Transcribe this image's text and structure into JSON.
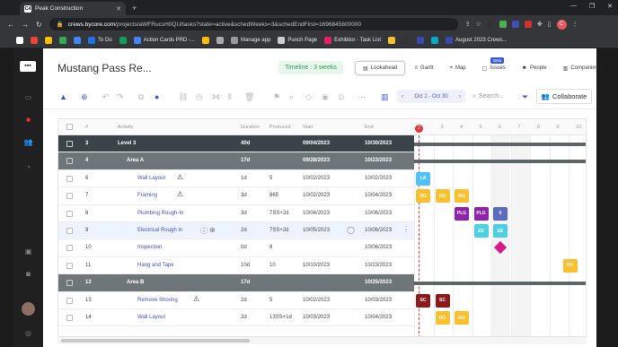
{
  "browser": {
    "tab_title": "Peak Construction",
    "tab_favicon": "C4",
    "url_host": "crews.bycore.com",
    "url_path": "/projects/aWFRucsH0QU/tasks?state=active&schedWeeks=3&schedEndFirst=1696845600000",
    "bookmarks": [
      "To Do",
      "Action Cards PRD -...",
      "Manage app",
      "Punch Page",
      "Exhibitor - Task List",
      "August 2023 Crews..."
    ]
  },
  "header": {
    "project_title": "Mustang Pass Re...",
    "timeline_label": "Timeline : 3 weeks",
    "beta_badge": "Beta",
    "views": [
      "Lookahead",
      "Gantt",
      "Map",
      "Issues",
      "People",
      "Companies"
    ]
  },
  "toolbar": {
    "date_range": "Oct 2 - Oct 30",
    "search_placeholder": "Search...",
    "collaborate_label": "Collaborate"
  },
  "table": {
    "columns": [
      "#",
      "Activity",
      "Duration",
      "Produced",
      "Start",
      "End"
    ],
    "rows": [
      {
        "num": "3",
        "activity": "Level 3",
        "duration": "40d",
        "produced": "",
        "start": "09/04/2023",
        "end": "10/30/2023",
        "kind": "group"
      },
      {
        "num": "4",
        "activity": "Area A",
        "duration": "17d",
        "produced": "",
        "start": "09/28/2023",
        "end": "10/23/2023",
        "kind": "sub"
      },
      {
        "num": "6",
        "activity": "Wall Layout",
        "duration": "1d",
        "produced": "5",
        "start": "10/02/2023",
        "end": "10/02/2023",
        "kind": "task",
        "warn": true
      },
      {
        "num": "7",
        "activity": "Framing",
        "duration": "3d",
        "produced": "865",
        "start": "10/02/2023",
        "end": "10/04/2023",
        "kind": "task",
        "warn": true
      },
      {
        "num": "8",
        "activity": "Plumbing Rough-In",
        "duration": "3d",
        "produced": "7SS+2d",
        "start": "10/04/2023",
        "end": "10/06/2023",
        "kind": "task"
      },
      {
        "num": "9",
        "activity": "Electrical Rough In",
        "duration": "2d",
        "produced": "7SS+2d",
        "start": "10/05/2023",
        "end": "10/06/2023",
        "kind": "sel"
      },
      {
        "num": "10",
        "activity": "Inspection",
        "duration": "0d",
        "produced": "8",
        "start": "",
        "end": "10/06/2023",
        "kind": "task"
      },
      {
        "num": "11",
        "activity": "Hang and Tape",
        "duration": "10d",
        "produced": "10",
        "start": "10/10/2023",
        "end": "10/23/2023",
        "kind": "task"
      },
      {
        "num": "12",
        "activity": "Area B",
        "duration": "17d",
        "produced": "",
        "start": "",
        "end": "10/25/2023",
        "kind": "sub"
      },
      {
        "num": "13",
        "activity": "Remove Shoring",
        "duration": "2d",
        "produced": "5",
        "start": "10/02/2023",
        "end": "10/03/2023",
        "kind": "task",
        "warn": true
      },
      {
        "num": "14",
        "activity": "Wall Layout",
        "duration": "2d",
        "produced": "13SS+1d",
        "start": "10/03/2023",
        "end": "10/04/2023",
        "kind": "task"
      }
    ]
  },
  "gantt": {
    "today_label": "2",
    "day_labels": [
      "2",
      "3",
      "4",
      "5",
      "6",
      "7",
      "8",
      "9",
      "10"
    ],
    "blocks": [
      {
        "label": "LA",
        "color": "#4fc3f7"
      },
      {
        "label": "DO",
        "color": "#fbc02d"
      },
      {
        "label": "DO",
        "color": "#fbc02d"
      },
      {
        "label": "DO",
        "color": "#fbc02d"
      },
      {
        "label": "PLG",
        "color": "#8e24aa"
      },
      {
        "label": "PLG",
        "color": "#8e24aa"
      },
      {
        "label": "X",
        "color": "#5c6bc0"
      },
      {
        "label": "EE",
        "color": "#4dd0e1"
      },
      {
        "label": "EE",
        "color": "#4dd0e1"
      },
      {
        "label": "SC",
        "color": "#8b1a1a"
      },
      {
        "label": "SC",
        "color": "#8b1a1a"
      },
      {
        "label": "DO",
        "color": "#fbc02d"
      },
      {
        "label": "DO",
        "color": "#fbc02d"
      }
    ]
  }
}
